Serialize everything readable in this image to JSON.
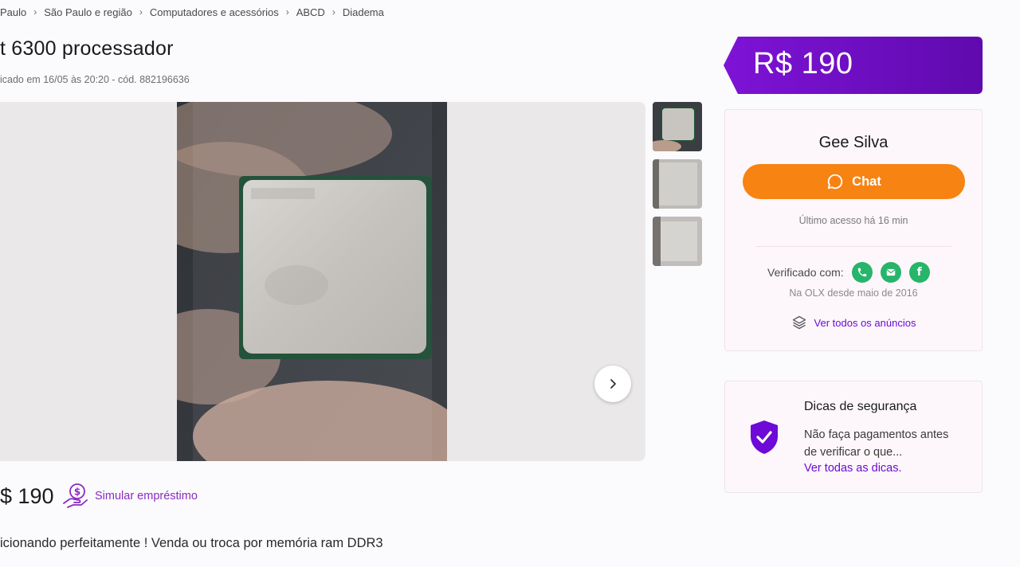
{
  "breadcrumb": [
    "Paulo",
    "São Paulo e região",
    "Computadores e acessórios",
    "ABCD",
    "Diadema"
  ],
  "listing": {
    "title": "t 6300 processador",
    "meta": "icado em 16/05 às 20:20 - cód. 882196636",
    "price": "R$ 190",
    "price_bottom": "$ 190",
    "loan_label": "Simular empréstimo",
    "description": "icionando perfeitamente ! Venda ou troca por memória ram DDR3"
  },
  "price_tag": {
    "text": "R$ 190"
  },
  "seller": {
    "name": "Gee Silva",
    "chat_label": "Chat",
    "last_access": "Último acesso há 16 min",
    "verified_label": "Verificado com:",
    "since": "Na OLX desde maio de 2016",
    "all_ads_label": "Ver todos os anúncios"
  },
  "tips": {
    "title": "Dicas de segurança",
    "text": "Não faça pagamentos antes de verificar o que...",
    "link": "Ver todas as dicas."
  },
  "colors": {
    "brand_purple": "#6d0ad6",
    "chat_orange": "#f78312",
    "verified_green": "#26b56a"
  },
  "icons": {
    "verified": [
      "phone-icon",
      "email-icon",
      "facebook-icon"
    ],
    "nav_next": "chevron-right-icon",
    "all_ads": "layers-icon",
    "tips": "shield-check-icon",
    "loan": "money-hand-icon",
    "chat": "chat-bubble-icon"
  }
}
